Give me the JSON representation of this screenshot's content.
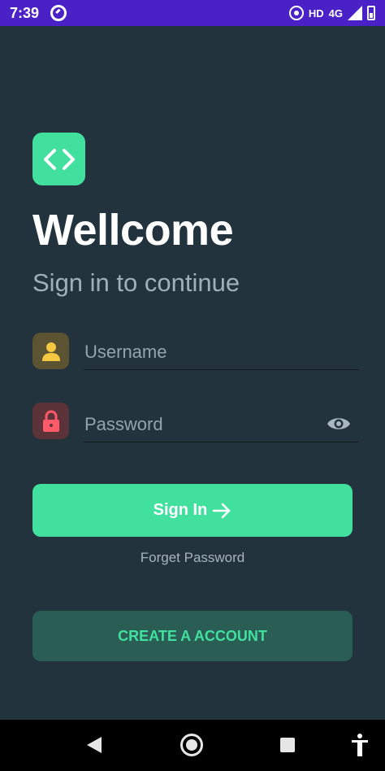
{
  "status_bar": {
    "time": "7:39",
    "network_label": "HD",
    "network_type": "4G"
  },
  "logo": {
    "icon": "code-brackets-icon",
    "color": "#42e09f"
  },
  "welcome": {
    "title": "Wellcome",
    "subtitle": "Sign in to continue"
  },
  "form": {
    "username_placeholder": "Username",
    "username_value": "",
    "password_placeholder": "Password",
    "password_value": ""
  },
  "actions": {
    "sign_in_label": "Sign In",
    "forget_password_label": "Forget Password",
    "create_account_label": "CREATE A ACCOUNT"
  },
  "colors": {
    "background": "#22333d",
    "accent": "#42e09f",
    "status_bar": "#4a21c7"
  }
}
